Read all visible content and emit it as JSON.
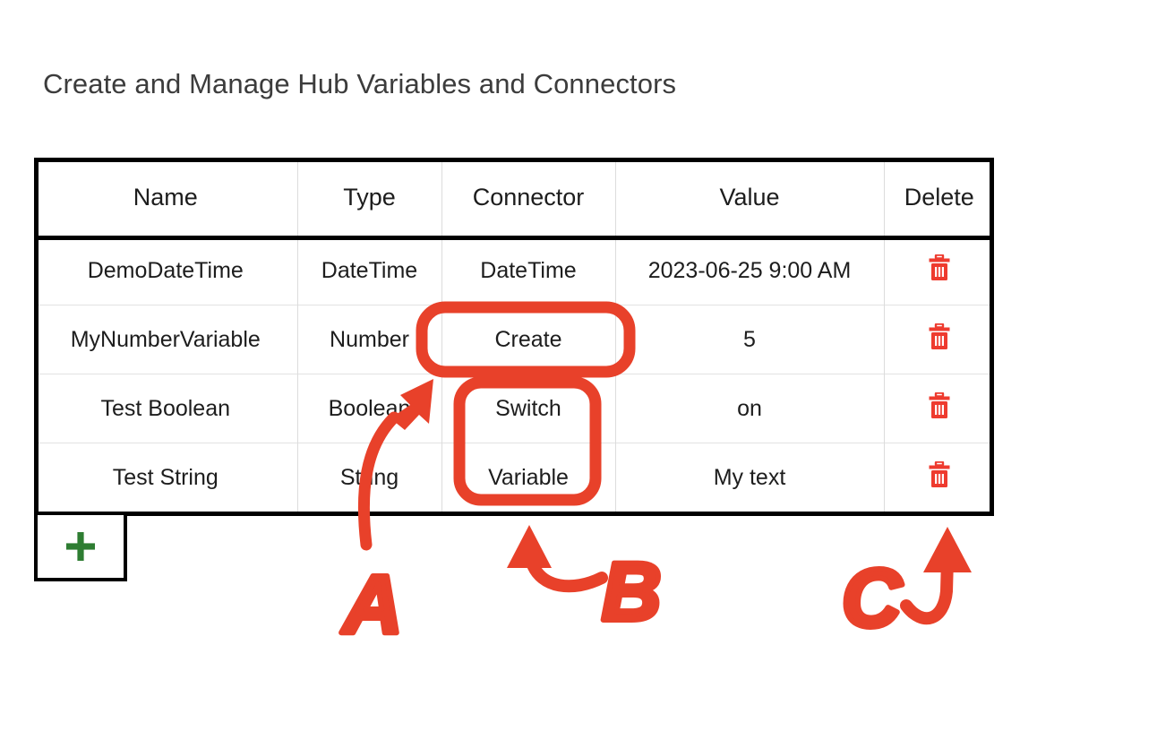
{
  "page": {
    "title": "Create and Manage Hub Variables and Connectors"
  },
  "colors": {
    "annotation_red": "#E8412A",
    "link_blue": "#4285C8",
    "create_green": "#2E7D32",
    "value_purple": "#7B1FA2",
    "delete_red": "#EE3B2F",
    "title_gray": "#3C3C3C",
    "table_border": "#000000",
    "grid_line": "#DCDCDC"
  },
  "table": {
    "columns": [
      "Name",
      "Type",
      "Connector",
      "Value",
      "Delete"
    ],
    "rows": [
      {
        "name": "DemoDateTime",
        "type": "DateTime",
        "connector": "DateTime",
        "connector_style": "link",
        "value": "2023-06-25 9:00 AM",
        "delete_icon": "trash-icon"
      },
      {
        "name": "MyNumberVariable",
        "type": "Number",
        "connector": "Create",
        "connector_style": "create",
        "value": "5",
        "delete_icon": "trash-icon"
      },
      {
        "name": "Test Boolean",
        "type": "Boolean",
        "connector": "Switch",
        "connector_style": "link",
        "value": "on",
        "delete_icon": "trash-icon"
      },
      {
        "name": "Test String",
        "type": "String",
        "connector": "Variable",
        "connector_style": "link",
        "value": "My text",
        "delete_icon": "trash-icon"
      }
    ]
  },
  "add_row_button": {
    "icon": "plus-icon",
    "label": "+"
  },
  "annotations": {
    "items": [
      {
        "id": "A",
        "label": "A",
        "kind": "rounded-rect-callout-with-curved-arrow",
        "targets": "Create connector cell in MyNumberVariable row"
      },
      {
        "id": "B",
        "label": "B",
        "kind": "rounded-rect-callout-with-curved-arrow",
        "targets": "Switch and Variable connector cells"
      },
      {
        "id": "C",
        "label": "C",
        "kind": "curved-arrow",
        "targets": "Delete column trash icons"
      }
    ]
  }
}
